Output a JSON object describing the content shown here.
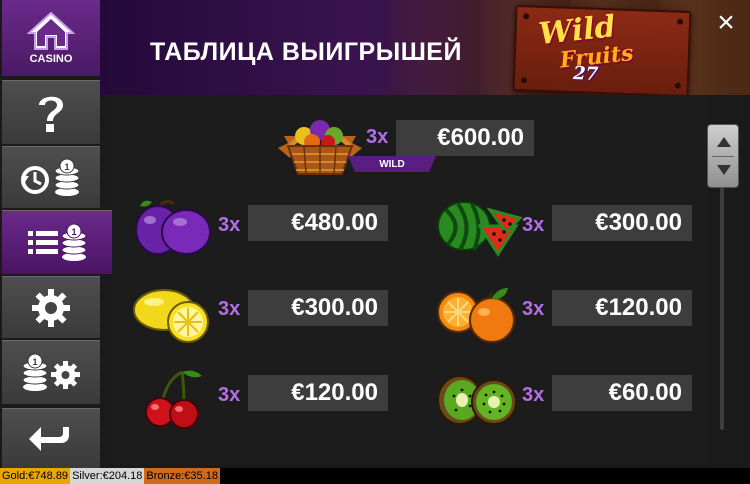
{
  "header": {
    "title": "ТАБЛИЦА ВЫИГРЫШЕЙ",
    "close_symbol": "×",
    "logo": {
      "line1": "Wild",
      "line2": "Fruits",
      "line3": "27"
    }
  },
  "sidebar": {
    "casino_label": "CASINO",
    "items": [
      {
        "name": "casino-home",
        "icon": "house-icon"
      },
      {
        "name": "help",
        "icon": "question-mark-icon"
      },
      {
        "name": "history",
        "icon": "history-coins-icon"
      },
      {
        "name": "paytable",
        "icon": "list-coins-icon",
        "active": true
      },
      {
        "name": "settings",
        "icon": "gear-icon"
      },
      {
        "name": "bet-settings",
        "icon": "coins-gear-icon"
      },
      {
        "name": "back",
        "icon": "back-arrow-icon"
      }
    ]
  },
  "paytable": {
    "wild": {
      "symbol": "fruit-basket",
      "multiplier": "3x",
      "prize": "€600.00",
      "tag": "WILD"
    },
    "rows": [
      {
        "symbol": "plum",
        "multiplier": "3x",
        "prize": "€480.00"
      },
      {
        "symbol": "watermelon",
        "multiplier": "3x",
        "prize": "€300.00"
      },
      {
        "symbol": "lemon",
        "multiplier": "3x",
        "prize": "€300.00"
      },
      {
        "symbol": "orange",
        "multiplier": "3x",
        "prize": "€120.00"
      },
      {
        "symbol": "cherry",
        "multiplier": "3x",
        "prize": "€120.00"
      },
      {
        "symbol": "kiwi",
        "multiplier": "3x",
        "prize": "€60.00"
      }
    ]
  },
  "jackpots": {
    "gold": "Gold:€748.89",
    "silver": "Silver:€204.18",
    "bronze": "Bronze:€35.18"
  },
  "colors": {
    "accent_purple": "#5a1e82",
    "multiplier_text": "#b56ee8",
    "prize_box": "#3d3d3d",
    "gold": "#e8a800",
    "silver": "#d6d6d6",
    "bronze": "#d06a1a"
  }
}
